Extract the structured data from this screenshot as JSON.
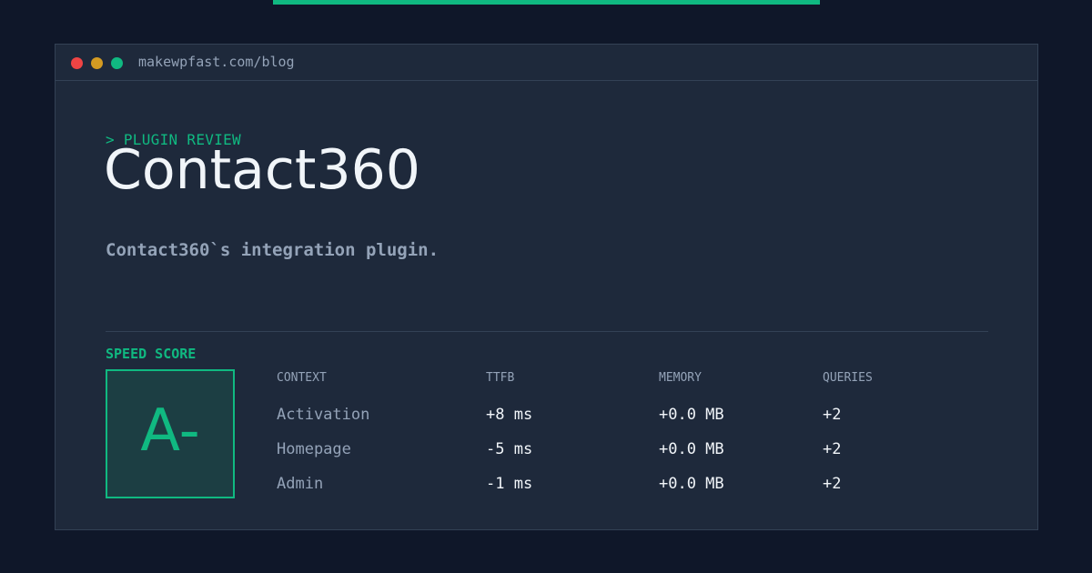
{
  "colors": {
    "background": "#0f1729",
    "window": "#1e293b",
    "accent": "#10b981",
    "muted_text": "#94a3b8",
    "primary_text": "#f1f5f9"
  },
  "window": {
    "url": "makewpfast.com/blog"
  },
  "hero": {
    "eyebrow": "> PLUGIN REVIEW",
    "title": "Contact360",
    "subtitle": "Contact360`s integration plugin."
  },
  "score": {
    "label": "SPEED SCORE",
    "grade": "A-"
  },
  "table": {
    "headers": [
      "CONTEXT",
      "TTFB",
      "MEMORY",
      "QUERIES"
    ],
    "rows": [
      [
        "Activation",
        "+8 ms",
        "+0.0 MB",
        "+2"
      ],
      [
        "Homepage",
        "-5 ms",
        "+0.0 MB",
        "+2"
      ],
      [
        "Admin",
        "-1 ms",
        "+0.0 MB",
        "+2"
      ]
    ]
  }
}
